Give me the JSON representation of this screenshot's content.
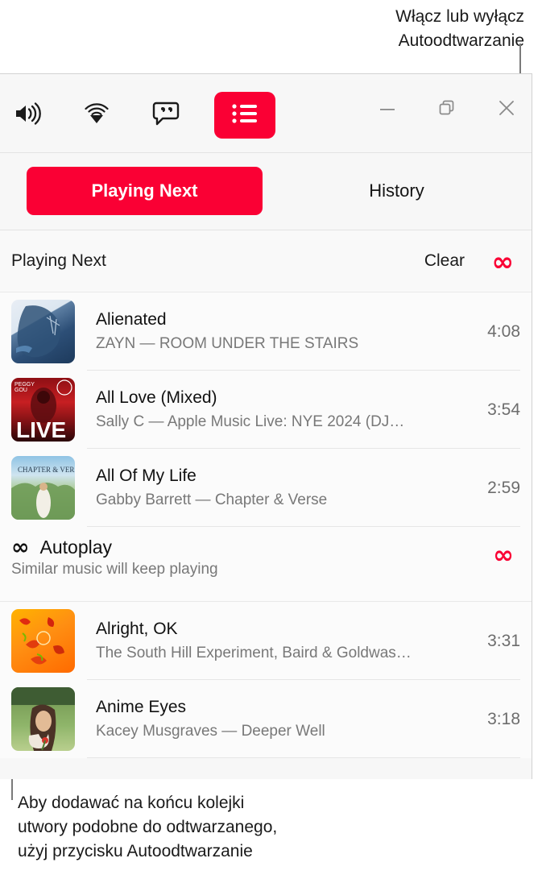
{
  "callouts": {
    "top": "Włącz lub wyłącz\nAutoodtwarzanie",
    "bottom": "Aby dodawać na końcu kolejki\nutwory podobne do odtwarzanego,\nużyj przycisku Autoodtwarzanie"
  },
  "toolbar": {
    "icons": [
      {
        "name": "volume-icon",
        "label": "Volume"
      },
      {
        "name": "airplay-icon",
        "label": "AirPlay"
      },
      {
        "name": "lyrics-icon",
        "label": "Lyrics"
      },
      {
        "name": "queue-icon",
        "label": "Queue",
        "active": true
      }
    ],
    "window_controls": [
      {
        "name": "minimize-button",
        "label": "Minimize"
      },
      {
        "name": "restore-button",
        "label": "Restore"
      },
      {
        "name": "close-button",
        "label": "Close"
      }
    ]
  },
  "tabs": [
    {
      "label": "Playing Next",
      "selected": true
    },
    {
      "label": "History",
      "selected": false
    }
  ],
  "section": {
    "title": "Playing Next",
    "clear_label": "Clear",
    "infinity_glyph": "∞"
  },
  "queue": [
    {
      "title": "Alienated",
      "subtitle": "ZAYN — ROOM UNDER THE STAIRS",
      "duration": "4:08"
    },
    {
      "title": "All Love (Mixed)",
      "subtitle": "Sally C — Apple Music Live: NYE 2024 (DJ…",
      "duration": "3:54"
    },
    {
      "title": "All Of My Life",
      "subtitle": "Gabby Barrett — Chapter & Verse",
      "duration": "2:59"
    }
  ],
  "autoplay": {
    "glyph": "∞",
    "name": "Autoplay",
    "subtitle": "Similar music will keep playing",
    "toggle_glyph": "∞"
  },
  "autoplay_queue": [
    {
      "title": "Alright, OK",
      "subtitle": "The South Hill Experiment, Baird & Goldwas…",
      "duration": "3:31"
    },
    {
      "title": "Anime Eyes",
      "subtitle": "Kacey Musgraves — Deeper Well",
      "duration": "3:18"
    }
  ],
  "colors": {
    "accent": "#fa0034",
    "window_bg": "#f7f7f7",
    "list_bg": "#fbfbfb"
  }
}
